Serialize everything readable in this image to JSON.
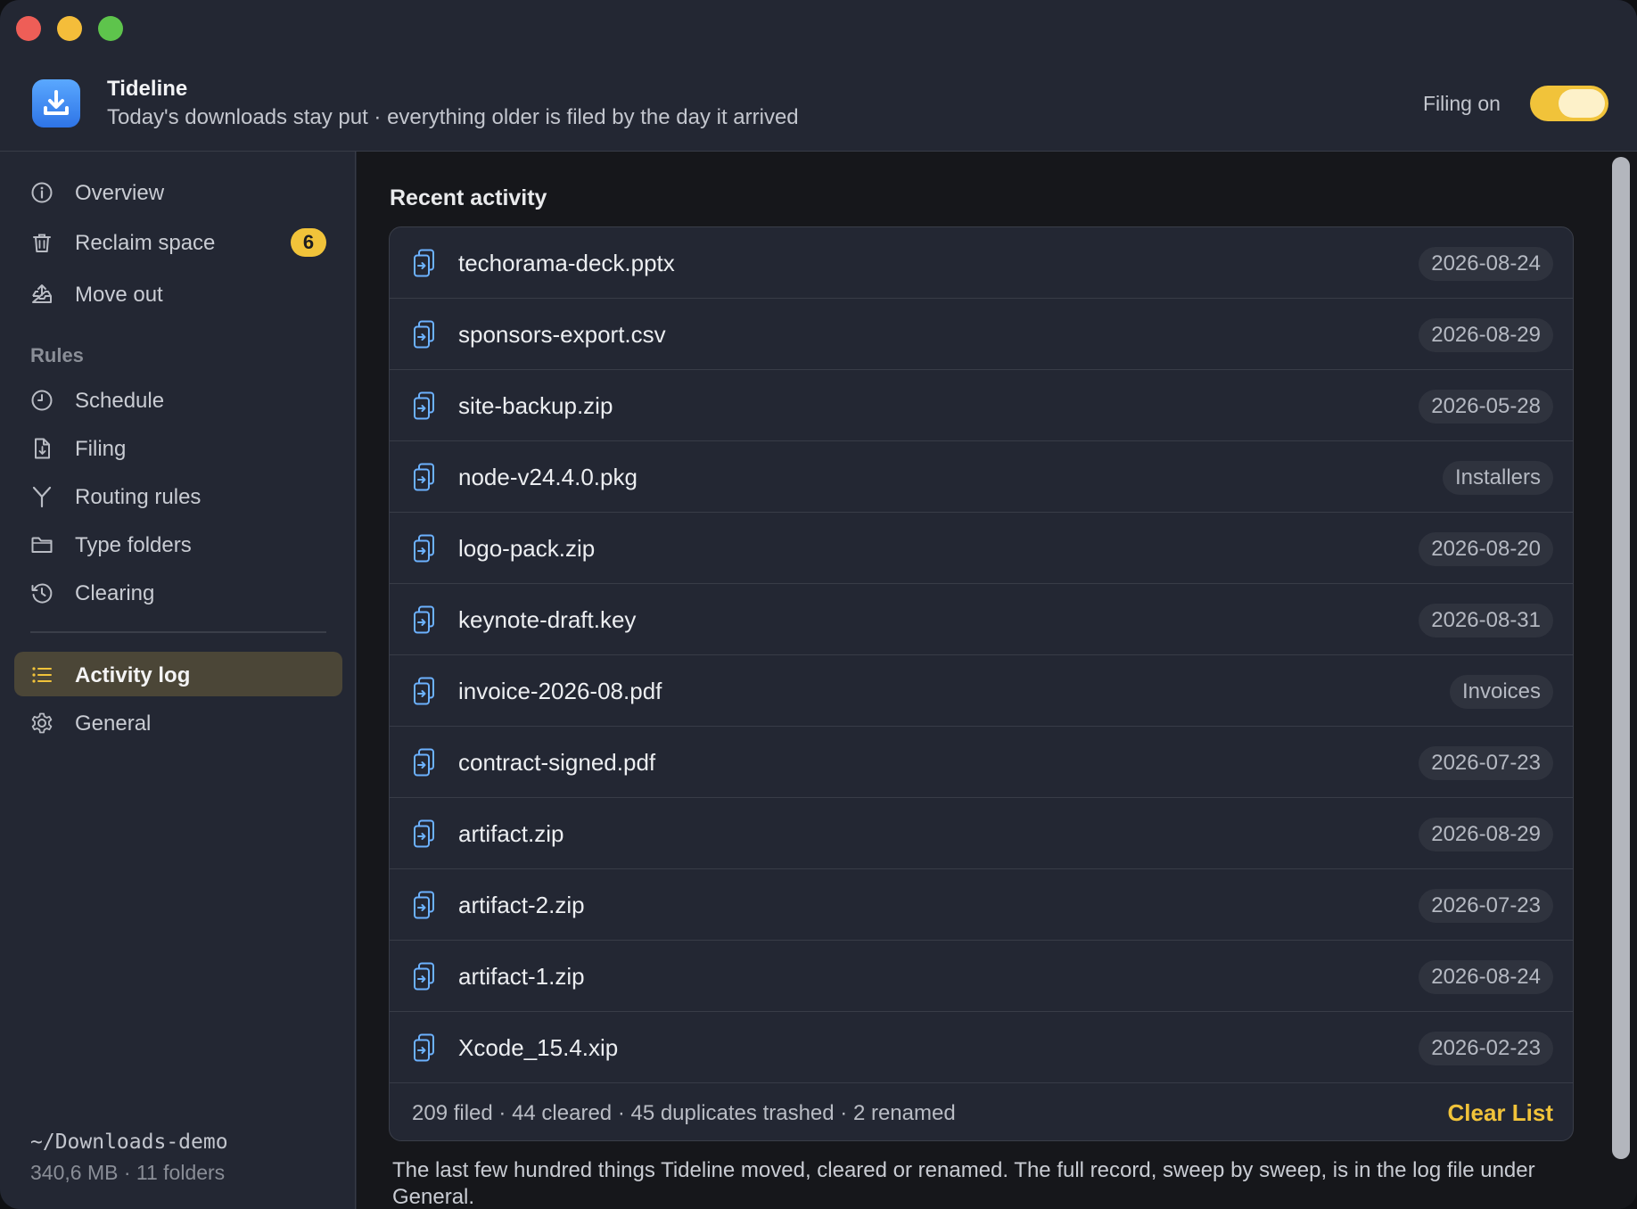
{
  "window": {
    "controls": [
      "close",
      "minimize",
      "zoom"
    ]
  },
  "header": {
    "app_name": "Tideline",
    "subtitle": "Today's downloads stay put · everything older is filed by the day it arrived",
    "filing_label": "Filing on",
    "filing_enabled": true,
    "app_icon": "download-tray-icon",
    "accent_color": "#f1c33a"
  },
  "sidebar": {
    "items_top": [
      {
        "label": "Overview",
        "icon": "info-icon"
      },
      {
        "label": "Reclaim space",
        "icon": "trash-icon",
        "badge": "6"
      },
      {
        "label": "Move out",
        "icon": "tray-arrow-icon"
      }
    ],
    "rules_label": "Rules",
    "rules_items": [
      {
        "label": "Schedule",
        "icon": "clock-icon"
      },
      {
        "label": "Filing",
        "icon": "document-arrow-icon"
      },
      {
        "label": "Routing rules",
        "icon": "fork-icon"
      },
      {
        "label": "Type folders",
        "icon": "folder-icon"
      },
      {
        "label": "Clearing",
        "icon": "history-icon"
      }
    ],
    "items_bottom": [
      {
        "label": "Activity log",
        "icon": "list-icon",
        "active": true
      },
      {
        "label": "General",
        "icon": "gear-icon"
      }
    ],
    "footer": {
      "path": "~/Downloads-demo",
      "stats": "340,6 MB · 11 folders"
    }
  },
  "main": {
    "title": "Recent activity",
    "rows": [
      {
        "name": "techorama-deck.pptx",
        "tag": "2026-08-24"
      },
      {
        "name": "sponsors-export.csv",
        "tag": "2026-08-29"
      },
      {
        "name": "site-backup.zip",
        "tag": "2026-05-28"
      },
      {
        "name": "node-v24.4.0.pkg",
        "tag": "Installers"
      },
      {
        "name": "logo-pack.zip",
        "tag": "2026-08-20"
      },
      {
        "name": "keynote-draft.key",
        "tag": "2026-08-31"
      },
      {
        "name": "invoice-2026-08.pdf",
        "tag": "Invoices"
      },
      {
        "name": "contract-signed.pdf",
        "tag": "2026-07-23"
      },
      {
        "name": "artifact.zip",
        "tag": "2026-08-29"
      },
      {
        "name": "artifact-2.zip",
        "tag": "2026-07-23"
      },
      {
        "name": "artifact-1.zip",
        "tag": "2026-08-24"
      },
      {
        "name": "Xcode_15.4.xip",
        "tag": "2026-02-23"
      }
    ],
    "stats": "209 filed · 44 cleared · 45 duplicates trashed · 2 renamed",
    "clear_label": "Clear List",
    "note": "The last few hundred things Tideline moved, cleared or renamed. The full record, sweep by sweep, is in the log file under General."
  }
}
